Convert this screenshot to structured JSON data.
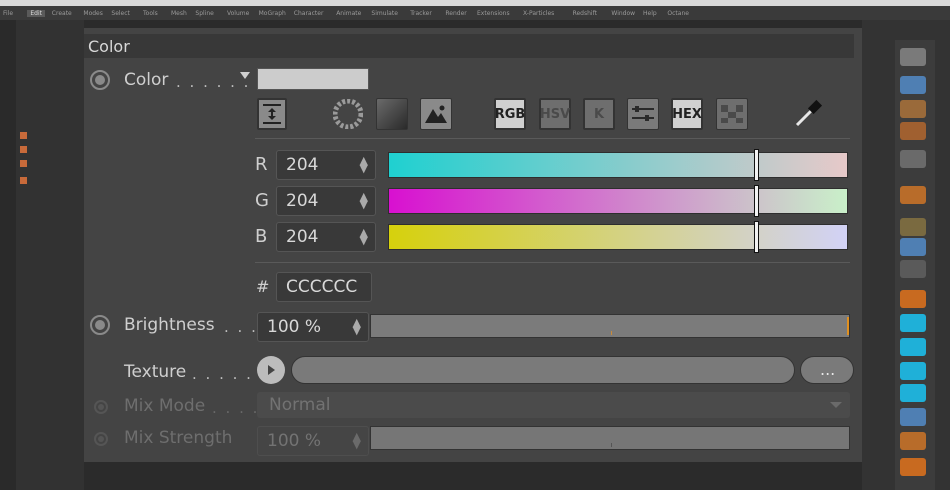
{
  "menubar": {
    "items": [
      "File",
      "Edit",
      "Create",
      "Modes",
      "Select",
      "Tools",
      "Mesh",
      "Spline",
      "Volume",
      "MoGraph",
      "Character",
      "Animate",
      "Simulate",
      "Tracker",
      "Render",
      "Extensions",
      "X-Particles",
      "Redshift",
      "Window",
      "Help",
      "Octane"
    ],
    "active_index": 1
  },
  "panel": {
    "title": "Color",
    "color": {
      "label": "Color",
      "dots": ". . . . . .",
      "swatch_hex": "#cccccc"
    },
    "modes": {
      "rgb": "RGB",
      "hsv": "HSV",
      "k": "K",
      "hex": "HEX"
    },
    "channels": [
      {
        "name": "R",
        "value": "204"
      },
      {
        "name": "G",
        "value": "204"
      },
      {
        "name": "B",
        "value": "204"
      }
    ],
    "channel_fraction": 0.8,
    "hex": {
      "symbol": "#",
      "value": "CCCCCC"
    },
    "brightness": {
      "label": "Brightness",
      "dots": ". . .",
      "value": "100 %"
    },
    "texture": {
      "label": "Texture",
      "dots": ". . . . . . .",
      "more": "..."
    },
    "mix_mode": {
      "label": "Mix Mode",
      "dots": ". . . .",
      "value": "Normal"
    },
    "mix_strength": {
      "label": "Mix Strength",
      "value": "100 %"
    }
  },
  "colors": {
    "r_gradient": [
      "#1fd0d0",
      "#e7c9c9"
    ],
    "g_gradient": [
      "#d810d0",
      "#c9f0c9"
    ],
    "b_gradient": [
      "#d6d10c",
      "#d2d2f6"
    ]
  }
}
